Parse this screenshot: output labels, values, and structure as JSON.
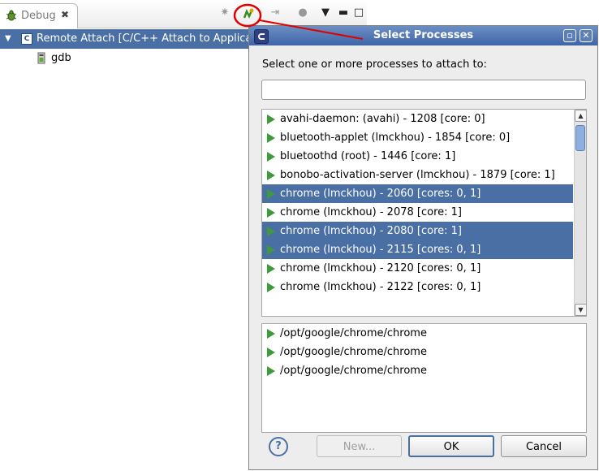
{
  "debug_view": {
    "tab_label": "Debug",
    "tree": [
      {
        "label": "Remote Attach [C/C++ Attach to Applica",
        "selected": true
      },
      {
        "label": "gdb",
        "selected": false
      }
    ]
  },
  "dialog": {
    "title": "Select Processes",
    "prompt": "Select one or more processes to attach to:",
    "filter": {
      "value": "",
      "placeholder": ""
    },
    "processes": [
      {
        "label": "avahi-daemon: (avahi) - 1208 [core: 0]",
        "selected": false
      },
      {
        "label": "bluetooth-applet (lmckhou) - 1854 [core: 0]",
        "selected": false
      },
      {
        "label": "bluetoothd (root) - 1446 [core: 1]",
        "selected": false
      },
      {
        "label": "bonobo-activation-server (lmckhou) - 1879 [core: 1]",
        "selected": false
      },
      {
        "label": "chrome (lmckhou) - 2060 [cores: 0, 1]",
        "selected": true
      },
      {
        "label": "chrome (lmckhou) - 2078 [core: 1]",
        "selected": false
      },
      {
        "label": "chrome (lmckhou) - 2080 [core: 1]",
        "selected": true
      },
      {
        "label": "chrome (lmckhou) - 2115 [cores: 0, 1]",
        "selected": true
      },
      {
        "label": "chrome (lmckhou) - 2120 [cores: 0, 1]",
        "selected": false
      },
      {
        "label": "chrome (lmckhou) - 2122 [cores: 0, 1]",
        "selected": false
      }
    ],
    "paths": [
      "/opt/google/chrome/chrome",
      "/opt/google/chrome/chrome",
      "/opt/google/chrome/chrome"
    ],
    "buttons": {
      "new": "New...",
      "ok": "OK",
      "cancel": "Cancel"
    },
    "icons": {
      "process": "play-icon",
      "help": "help-icon"
    },
    "colors": {
      "selection": "#4a6fa5",
      "process_icon": "#3d9b3d",
      "annotation": "#e00000"
    }
  }
}
